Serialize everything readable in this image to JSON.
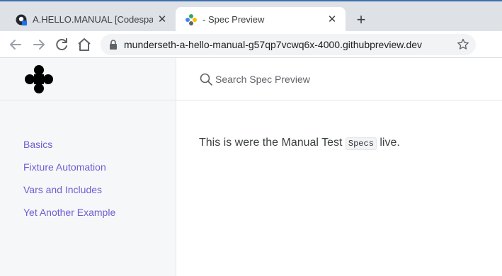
{
  "browser": {
    "tabs": [
      {
        "title": "A.HELLO.MANUAL [Codespaces]",
        "close": "✕",
        "active": false
      },
      {
        "title": "- Spec Preview",
        "close": "✕",
        "active": true
      }
    ],
    "new_tab": "+",
    "url": "munderseth-a-hello-manual-g57qp7vcwq6x-4000.githubpreview.dev",
    "extension_label": "•••",
    "icons": [
      "back-icon",
      "forward-icon",
      "reload-icon",
      "home-icon",
      "lock-icon",
      "star-icon"
    ]
  },
  "sidebar": {
    "items": [
      {
        "label": "Basics"
      },
      {
        "label": "Fixture Automation"
      },
      {
        "label": "Vars and Includes"
      },
      {
        "label": "Yet Another Example"
      }
    ]
  },
  "search": {
    "placeholder": "Search Spec Preview"
  },
  "content": {
    "before": "This is were the Manual Test ",
    "code": "Specs",
    "after": " live."
  },
  "colors": {
    "link": "#6b5fd3",
    "sidebar_bg": "#f6f7f9",
    "tabstrip_bg": "#dee1e6"
  }
}
